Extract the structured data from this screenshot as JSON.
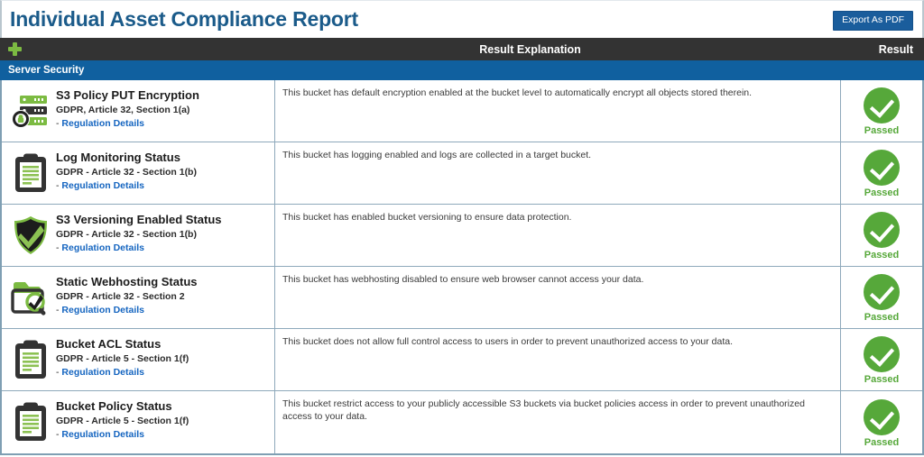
{
  "header": {
    "title": "Individual Asset Compliance Report",
    "export_label": "Export As PDF"
  },
  "columns": {
    "asset_icon": "plus-icon",
    "explanation": "Result Explanation",
    "result": "Result"
  },
  "group": {
    "label": "Server Security"
  },
  "link_prefix": "- ",
  "rows": [
    {
      "icon": "server-lock-icon",
      "name": "S3 Policy PUT Encryption",
      "regulation": "GDPR, Article 32, Section 1(a)",
      "link": "Regulation Details",
      "explanation": "This bucket has default encryption enabled at the bucket level to automatically encrypt all objects stored therein.",
      "result": "Passed"
    },
    {
      "icon": "clipboard-icon",
      "name": "Log Monitoring Status",
      "regulation": "GDPR - Article 32 - Section 1(b)",
      "link": "Regulation Details",
      "explanation": "This bucket has logging enabled and logs are collected in a target bucket.",
      "result": "Passed"
    },
    {
      "icon": "shield-check-icon",
      "name": "S3 Versioning Enabled Status",
      "regulation": "GDPR - Article 32 - Section 1(b)",
      "link": "Regulation Details",
      "explanation": "This bucket has enabled bucket versioning to ensure data protection.",
      "result": "Passed"
    },
    {
      "icon": "folder-search-check-icon",
      "name": "Static Webhosting Status",
      "regulation": "GDPR - Article 32 - Section 2",
      "link": "Regulation Details",
      "explanation": "This bucket has webhosting disabled to ensure web browser cannot access your data.",
      "result": "Passed"
    },
    {
      "icon": "clipboard-icon",
      "name": "Bucket ACL Status",
      "regulation": "GDPR - Article 5 - Section 1(f)",
      "link": "Regulation Details",
      "explanation": "This bucket does not allow full control access to users in order to prevent unauthorized access to your data.",
      "result": "Passed"
    },
    {
      "icon": "clipboard-icon",
      "name": "Bucket Policy Status",
      "regulation": "GDPR - Article 5 - Section 1(f)",
      "link": "Regulation Details",
      "explanation": "This bucket restrict access to your publicly accessible S3 buckets via bucket policies access in order to prevent unauthorized access to your data.",
      "result": "Passed"
    }
  ],
  "colors": {
    "title": "#1b5b8a",
    "group_header": "#10609f",
    "column_header": "#333333",
    "accent_green": "#7cbb42",
    "pass_green": "#56a83a",
    "link": "#1565c0",
    "border": "#8ea9bb"
  }
}
